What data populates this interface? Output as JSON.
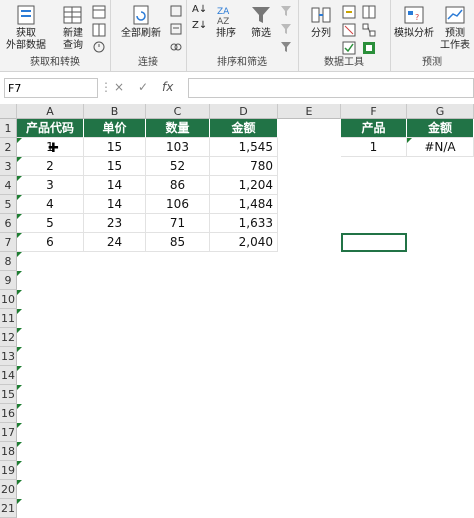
{
  "ribbon": {
    "get_data": "获取",
    "get_data2": "外部数据",
    "new_query": "新建",
    "new_query2": "查询",
    "group1": "获取和转换",
    "refresh_all": "全部刷新",
    "group2": "连接",
    "sort": "排序",
    "filter": "筛选",
    "group3": "排序和筛选",
    "split": "分列",
    "group4": "数据工具",
    "whatif": "模拟分析",
    "forecast": "预测",
    "forecast2": "工作表",
    "group5": "预测"
  },
  "formula_bar": {
    "name_box": "F7",
    "cancel": "×",
    "enter": "✓",
    "fx": "fx"
  },
  "columns": [
    "A",
    "B",
    "C",
    "D",
    "E",
    "F",
    "G"
  ],
  "rows": [
    "1",
    "2",
    "3",
    "4",
    "5",
    "6",
    "7",
    "8",
    "9",
    "10",
    "11",
    "12",
    "13",
    "14",
    "15",
    "16",
    "17",
    "18",
    "19",
    "20",
    "21"
  ],
  "table1": {
    "headers": [
      "产品代码",
      "单价",
      "数量",
      "金额"
    ],
    "rows": [
      [
        "1",
        "15",
        "103",
        "1,545"
      ],
      [
        "2",
        "15",
        "52",
        "780"
      ],
      [
        "3",
        "14",
        "86",
        "1,204"
      ],
      [
        "4",
        "14",
        "106",
        "1,484"
      ],
      [
        "5",
        "23",
        "71",
        "1,633"
      ],
      [
        "6",
        "24",
        "85",
        "2,040"
      ]
    ]
  },
  "table2": {
    "headers": [
      "产品",
      "金额"
    ],
    "row": [
      "1",
      "#N/A"
    ]
  },
  "colors": {
    "header_green": "#217346",
    "error_triangle": "#1e7d32"
  }
}
